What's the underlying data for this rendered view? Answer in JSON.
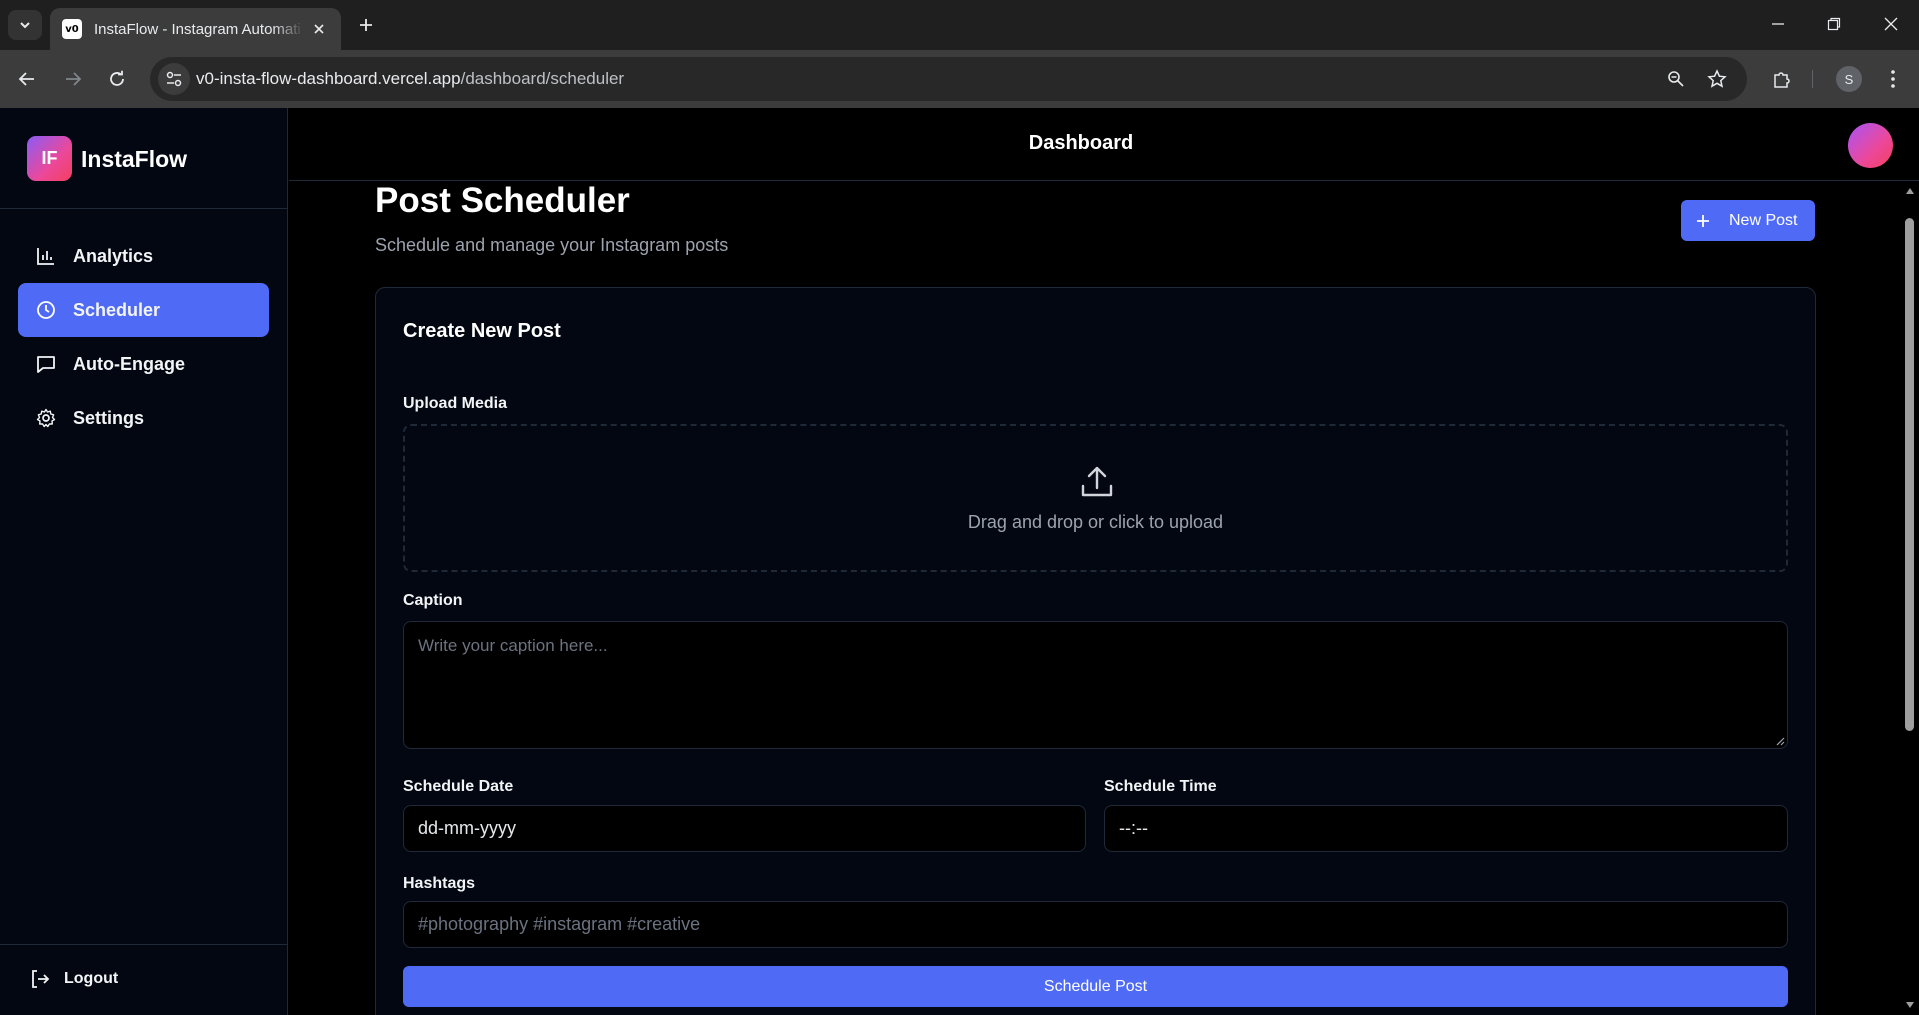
{
  "browser": {
    "tab_title": "InstaFlow - Instagram Automati",
    "favicon_text": "v0",
    "url_domain": "v0-insta-flow-dashboard.vercel.app",
    "url_path": "/dashboard/scheduler",
    "profile_initial": "S"
  },
  "sidebar": {
    "logo_text": "IF",
    "brand": "InstaFlow",
    "items": [
      {
        "label": "Analytics",
        "icon": "bar-chart-icon",
        "active": false
      },
      {
        "label": "Scheduler",
        "icon": "clock-icon",
        "active": true
      },
      {
        "label": "Auto-Engage",
        "icon": "message-square-icon",
        "active": false
      },
      {
        "label": "Settings",
        "icon": "gear-icon",
        "active": false
      }
    ],
    "logout_label": "Logout"
  },
  "header": {
    "title": "Dashboard"
  },
  "page": {
    "title": "Post Scheduler",
    "subtitle": "Schedule and manage your Instagram posts",
    "new_post_label": "New Post"
  },
  "form": {
    "title": "Create New Post",
    "upload_label": "Upload Media",
    "upload_text": "Drag and drop or click to upload",
    "caption_label": "Caption",
    "caption_placeholder": "Write your caption here...",
    "date_label": "Schedule Date",
    "date_value": "dd-mm-yyyy",
    "time_label": "Schedule Time",
    "time_value": "--:--",
    "hashtags_label": "Hashtags",
    "hashtags_placeholder": "#photography #instagram #creative",
    "submit_label": "Schedule Post"
  },
  "colors": {
    "accent": "#4f6bf5",
    "background": "#000000",
    "panel": "#030712",
    "border": "#1f2937"
  }
}
